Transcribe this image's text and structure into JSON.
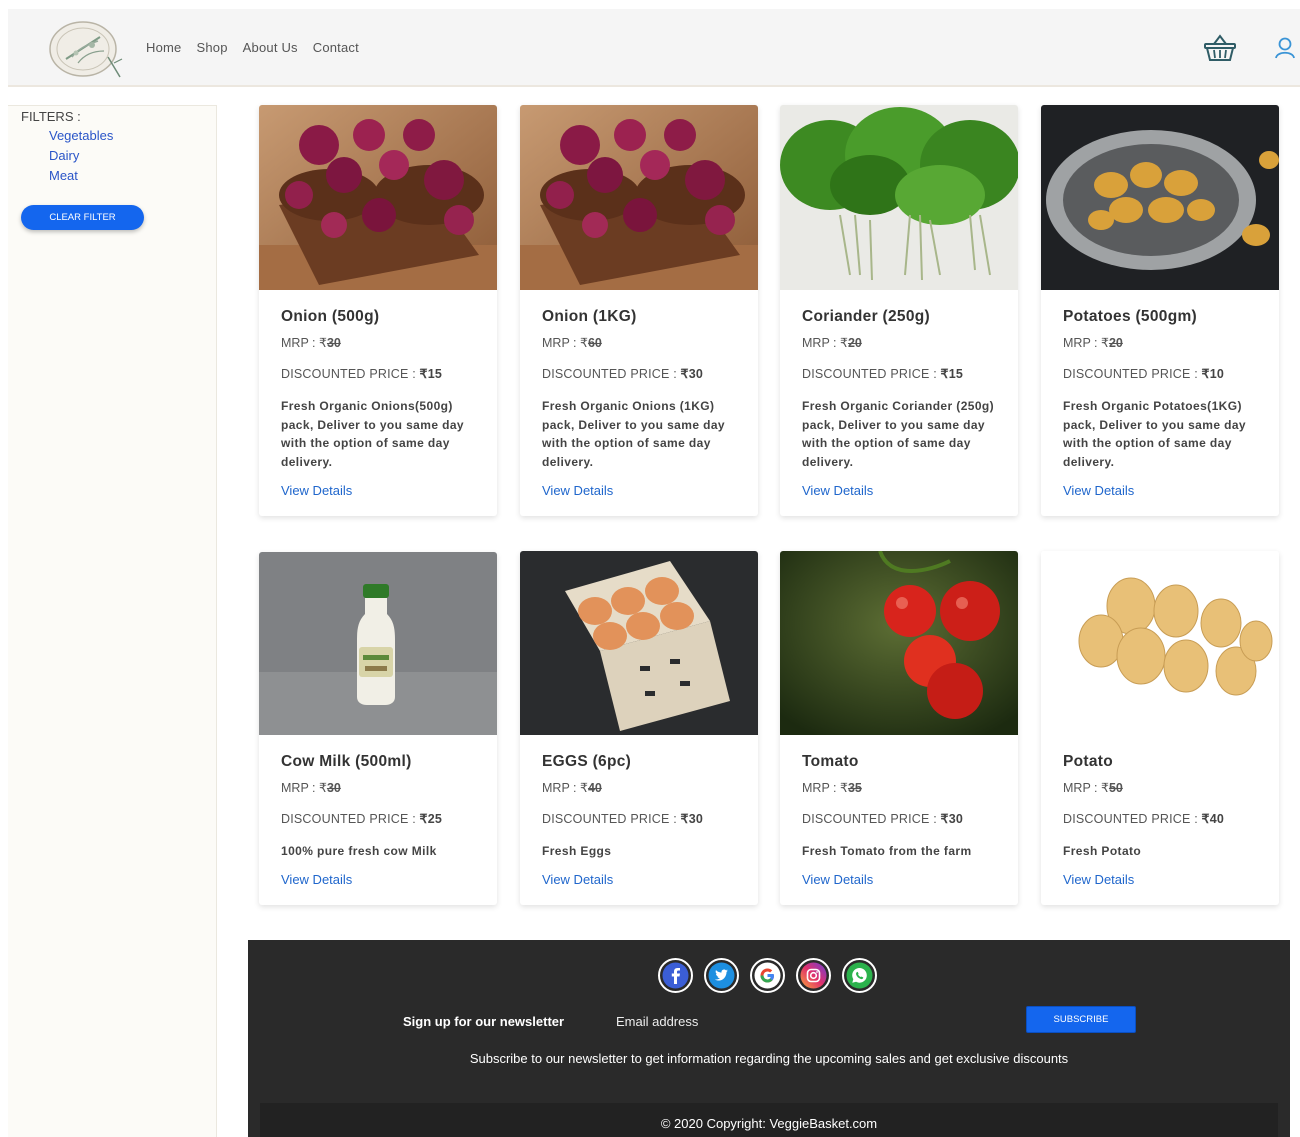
{
  "nav": {
    "links": [
      "Home",
      "Shop",
      "About Us",
      "Contact"
    ]
  },
  "sidebar": {
    "title": "FILTERS :",
    "filters": [
      "Vegetables",
      "Dairy",
      "Meat"
    ],
    "clear_button": "CLEAR FILTER"
  },
  "products": [
    {
      "name": "Onion (500g)",
      "mrp_label": "MRP : ₹",
      "mrp": "30",
      "disc_label": "DISCOUNTED PRICE : ",
      "disc": "₹15",
      "desc": "Fresh Organic Onions(500g) pack, Deliver to you same day with the option of same day delivery.",
      "link": "View Details"
    },
    {
      "name": "Onion (1KG)",
      "mrp_label": "MRP : ₹",
      "mrp": "60",
      "disc_label": "DISCOUNTED PRICE : ",
      "disc": "₹30",
      "desc": "Fresh Organic Onions (1KG) pack, Deliver to you same day with the option of same day delivery.",
      "link": "View Details"
    },
    {
      "name": "Coriander (250g)",
      "mrp_label": "MRP : ₹",
      "mrp": "20",
      "disc_label": "DISCOUNTED PRICE : ",
      "disc": "₹15",
      "desc": "Fresh Organic Coriander (250g) pack, Deliver to you same day with the option of same day delivery.",
      "link": "View Details"
    },
    {
      "name": "Potatoes (500gm)",
      "mrp_label": "MRP : ₹",
      "mrp": "20",
      "disc_label": "DISCOUNTED PRICE : ",
      "disc": "₹10",
      "desc": "Fresh Organic Potatoes(1KG) pack, Deliver to you same day with the option of same day delivery.",
      "link": "View Details"
    },
    {
      "name": "Cow Milk (500ml)",
      "mrp_label": "MRP : ₹",
      "mrp": "30",
      "disc_label": "DISCOUNTED PRICE : ",
      "disc": "₹25",
      "desc": "100% pure fresh cow Milk",
      "link": "View Details"
    },
    {
      "name": "EGGS (6pc)",
      "mrp_label": "MRP : ₹",
      "mrp": "40",
      "disc_label": "DISCOUNTED PRICE : ",
      "disc": "₹30",
      "desc": "Fresh Eggs",
      "link": "View Details"
    },
    {
      "name": "Tomato",
      "mrp_label": "MRP : ₹",
      "mrp": "35",
      "disc_label": "DISCOUNTED PRICE : ",
      "disc": "₹30",
      "desc": "Fresh Tomato from the farm",
      "link": "View Details"
    },
    {
      "name": "Potato",
      "mrp_label": "MRP : ₹",
      "mrp": "50",
      "disc_label": "DISCOUNTED PRICE : ",
      "disc": "₹40",
      "desc": "Fresh Potato",
      "link": "View Details"
    }
  ],
  "footer": {
    "socials": [
      "facebook-icon",
      "twitter-icon",
      "google-icon",
      "instagram-icon",
      "whatsapp-icon"
    ],
    "newsletter_label": "Sign up for our newsletter",
    "email_placeholder": "Email address",
    "subscribe_button": "SUBSCRIBE",
    "subscribe_text": "Subscribe to our newsletter to get information regarding the upcoming sales and get exclusive discounts",
    "copyright": "© 2020 Copyright: VeggieBasket.com"
  },
  "colors": {
    "accent": "#1466ee",
    "link": "#1f66cc",
    "footer_bg": "#2a2a2a"
  }
}
